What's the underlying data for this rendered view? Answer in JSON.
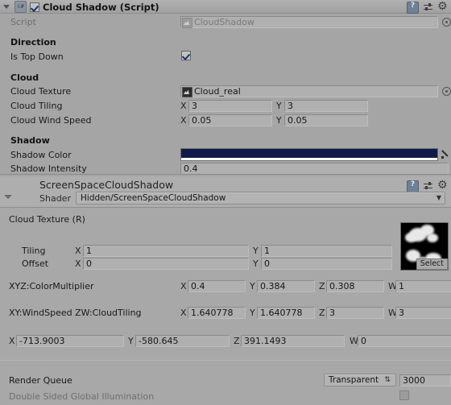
{
  "component": {
    "title": "Cloud Shadow (Script)",
    "enabled_checkbox": "checked",
    "icon_label": "c#",
    "script_label": "Script",
    "script_value": "CloudShadow",
    "sections": [
      {
        "header": "Direction",
        "rows": [
          {
            "label": "Is Top Down",
            "type": "bool",
            "value": "checked"
          }
        ]
      },
      {
        "header": "Cloud",
        "rows": [
          {
            "label": "Cloud Texture",
            "type": "object",
            "value": "Cloud_real"
          },
          {
            "label": "Cloud Tiling",
            "type": "vector2",
            "x_axis": "X",
            "x": "3",
            "y_axis": "Y",
            "y": "3"
          },
          {
            "label": "Cloud Wind Speed",
            "type": "vector2",
            "x_axis": "X",
            "x": "0.05",
            "y_axis": "Y",
            "y": "0.05"
          }
        ]
      },
      {
        "header": "Shadow",
        "rows": [
          {
            "label": "Shadow Color",
            "type": "color",
            "value": "#101a4a",
            "alpha": "#ffffff"
          },
          {
            "label": "Shadow Intensity",
            "type": "float",
            "value": "0.4"
          }
        ]
      }
    ]
  },
  "material": {
    "name": "ScreenSpaceCloudShadow",
    "shader_label": "Shader",
    "shader_value": "Hidden/ScreenSpaceCloudShadow",
    "texture_property": {
      "label": "Cloud Texture (R)",
      "select_button": "Select",
      "tiling_label": "Tiling",
      "tiling_x_axis": "X",
      "tiling_x": "1",
      "tiling_y_axis": "Y",
      "tiling_y": "1",
      "offset_label": "Offset",
      "offset_x_axis": "X",
      "offset_x": "0",
      "offset_y_axis": "Y",
      "offset_y": "0"
    },
    "vector_properties": [
      {
        "label": "XYZ:ColorMultiplier",
        "x_axis": "X",
        "x": "0.4",
        "y_axis": "Y",
        "y": "0.384",
        "z_axis": "Z",
        "z": "0.308",
        "w_axis": "W",
        "w": "1"
      },
      {
        "label": "XY:WindSpeed ZW:CloudTiling",
        "x_axis": "X",
        "x": "1.640778",
        "y_axis": "Y",
        "y": "1.640778",
        "z_axis": "Z",
        "z": "3",
        "w_axis": "W",
        "w": "3"
      },
      {
        "label": "",
        "x_axis": "X",
        "x": "-713.9003",
        "y_axis": "Y",
        "y": "-580.645",
        "z_axis": "Z",
        "z": "391.1493",
        "w_axis": "W",
        "w": "0"
      }
    ],
    "render_queue": {
      "label": "Render Queue",
      "dropdown_value": "Transparent",
      "numeric_value": "3000"
    },
    "double_sided_gi": {
      "label": "Double Sided Global Illumination",
      "value": "unchecked"
    }
  },
  "icons": {
    "help": "help-icon",
    "preset": "preset-icon",
    "gear": "gear-icon"
  },
  "colors": {
    "panel_bg": "#a5a5a5",
    "material_bg": "#a8a8a8",
    "field_bg": "#b0b0b0",
    "shadow_color": "#101a4a"
  }
}
